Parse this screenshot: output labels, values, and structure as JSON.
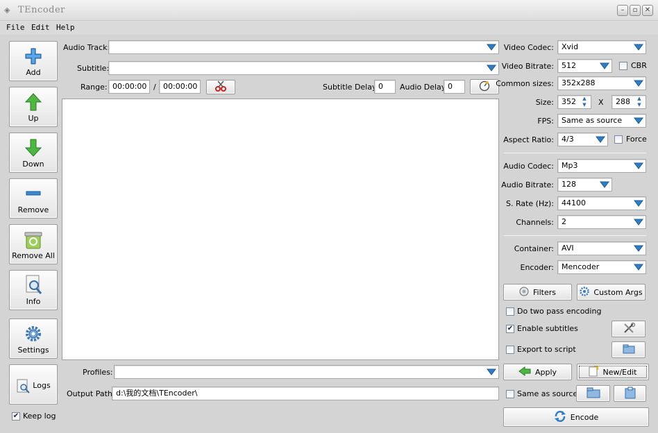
{
  "window": {
    "title": "TEncoder"
  },
  "menu": [
    "File",
    "Edit",
    "Help"
  ],
  "toolbar": {
    "add": "Add",
    "up": "Up",
    "down": "Down",
    "remove": "Remove",
    "remove_all": "Remove All",
    "info": "Info",
    "settings": "Settings",
    "logs": "Logs",
    "keep_log": "Keep log"
  },
  "source": {
    "audio_track_label": "Audio Track:",
    "audio_track_value": "",
    "subtitle_label": "Subtitle:",
    "subtitle_value": "",
    "range_label": "Range:",
    "range_start": "00:00:00",
    "range_sep": "/",
    "range_end": "00:00:00",
    "subtitle_delay_label": "Subtitle Delay:",
    "subtitle_delay": "0",
    "audio_delay_label": "Audio Delay:",
    "audio_delay": "0",
    "profiles_label": "Profiles:",
    "profiles_value": "",
    "output_path_label": "Output Path:",
    "output_path": "d:\\我的文档\\TEncoder\\"
  },
  "video": {
    "codec_label": "Video Codec:",
    "codec": "Xvid",
    "bitrate_label": "Video Bitrate:",
    "bitrate": "512",
    "cbr_label": "CBR",
    "common_sizes_label": "Common sizes:",
    "common_size": "352x288",
    "size_label": "Size:",
    "width": "352",
    "x_label": "X",
    "height": "288",
    "fps_label": "FPS:",
    "fps": "Same as source",
    "aspect_label": "Aspect Ratio:",
    "aspect": "4/3",
    "force_label": "Force"
  },
  "audio": {
    "codec_label": "Audio Codec:",
    "codec": "Mp3",
    "bitrate_label": "Audio Bitrate:",
    "bitrate": "128",
    "rate_label": "S. Rate (Hz):",
    "rate": "44100",
    "channels_label": "Channels:",
    "channels": "2"
  },
  "output": {
    "container_label": "Container:",
    "container": "AVI",
    "encoder_label": "Encoder:",
    "encoder": "Mencoder"
  },
  "actions": {
    "filters": "Filters",
    "custom_args": "Custom Args",
    "two_pass": "Do two pass encoding",
    "enable_subtitles": "Enable subtitles",
    "export_script": "Export to script",
    "apply": "Apply",
    "new_edit": "New/Edit",
    "same_as_source": "Same as source",
    "encode": "Encode"
  },
  "colors": {
    "accent_blue": "#2f7dc4",
    "accent_green": "#3fa535",
    "title_text": "#8a8a8a"
  }
}
